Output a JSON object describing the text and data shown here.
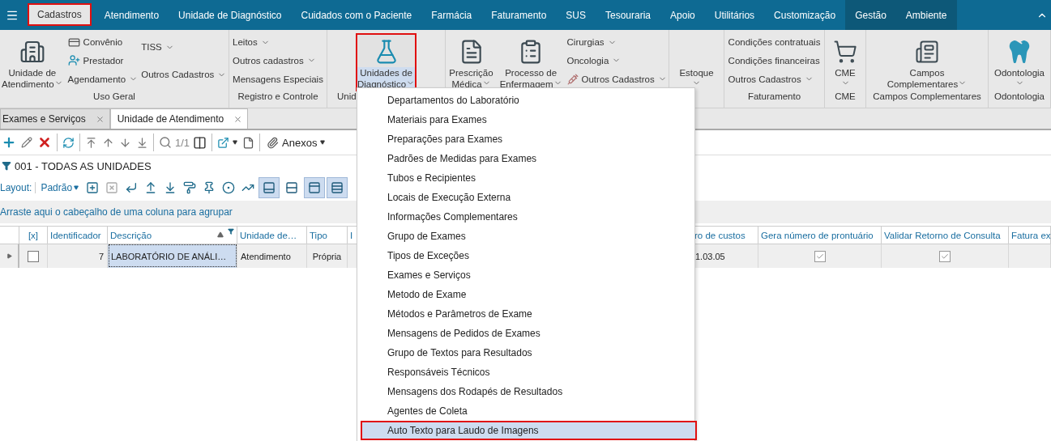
{
  "menu_bar": {
    "tabs": [
      {
        "label": "Cadastros",
        "selected": true,
        "context": false,
        "marked": true
      },
      {
        "label": "Atendimento",
        "selected": false,
        "context": false,
        "marked": false
      },
      {
        "label": "Unidade de Diagnóstico",
        "selected": false,
        "context": false,
        "marked": false
      },
      {
        "label": "Cuidados com o Paciente",
        "selected": false,
        "context": false,
        "marked": false
      },
      {
        "label": "Farmácia",
        "selected": false,
        "context": false,
        "marked": false
      },
      {
        "label": "Faturamento",
        "selected": false,
        "context": false,
        "marked": false
      },
      {
        "label": "SUS",
        "selected": false,
        "context": false,
        "marked": false
      },
      {
        "label": "Tesouraria",
        "selected": false,
        "context": false,
        "marked": false
      },
      {
        "label": "Apoio",
        "selected": false,
        "context": false,
        "marked": false
      },
      {
        "label": "Utilitários",
        "selected": false,
        "context": false,
        "marked": false
      },
      {
        "label": "Customização",
        "selected": false,
        "context": false,
        "marked": false
      },
      {
        "label": "Gestão",
        "selected": false,
        "context": true,
        "marked": false
      },
      {
        "label": "Ambiente",
        "selected": false,
        "context": true,
        "marked": false
      }
    ]
  },
  "ribbon": {
    "groups": [
      {
        "label": "Uso Geral",
        "columns": [
          {
            "kind": "large",
            "lines": [
              "Unidade de",
              "Atendimento"
            ],
            "dropdown": true,
            "selected": false,
            "marked": false
          },
          {
            "kind": "stack",
            "items": [
              {
                "label": "Convênio",
                "dropdown": false
              },
              {
                "label": "Prestador",
                "dropdown": false
              },
              {
                "label": "Agendamento",
                "dropdown": true
              }
            ]
          },
          {
            "kind": "stack",
            "items": [
              {
                "label": "TISS",
                "dropdown": true
              },
              {
                "label": "Outros Cadastros",
                "dropdown": true
              }
            ]
          }
        ]
      },
      {
        "label": "Registro e Controle",
        "columns": [
          {
            "kind": "stack",
            "items": [
              {
                "label": "Leitos",
                "dropdown": true
              },
              {
                "label": "Outros cadastros",
                "dropdown": true
              },
              {
                "label": "Mensagens  Especiais",
                "dropdown": false
              }
            ]
          }
        ]
      },
      {
        "label": "Unid",
        "columns": [
          {
            "kind": "large",
            "lines": [
              "Unidades de",
              "Diagnóstico"
            ],
            "dropdown": true,
            "selected": true,
            "marked": true
          }
        ]
      },
      {
        "columns": [
          {
            "kind": "large",
            "lines": [
              "Prescrição",
              "Médica"
            ],
            "dropdown": true,
            "selected": false,
            "marked": false
          },
          {
            "kind": "large",
            "lines": [
              "Processo de",
              "Enfermagem"
            ],
            "dropdown": true,
            "selected": false,
            "marked": false
          },
          {
            "kind": "stack",
            "items": [
              {
                "label": "Cirurgias",
                "dropdown": true
              },
              {
                "label": "Oncologia",
                "dropdown": true
              },
              {
                "label": "Outros Cadastros",
                "dropdown": true
              }
            ]
          }
        ]
      },
      {
        "columns": [
          {
            "kind": "large",
            "lines": [
              "Estoque"
            ],
            "dropdown": true,
            "selected": false,
            "marked": false
          }
        ]
      },
      {
        "label": "Faturamento",
        "columns": [
          {
            "kind": "stack",
            "items": [
              {
                "label": "Condições contratuais",
                "dropdown": false
              },
              {
                "label": "Condições financeiras",
                "dropdown": false
              },
              {
                "label": "Outros Cadastros",
                "dropdown": true
              }
            ]
          }
        ]
      },
      {
        "label": "CME",
        "columns": [
          {
            "kind": "large",
            "lines": [
              "CME"
            ],
            "dropdown": true,
            "selected": false,
            "marked": false
          }
        ]
      },
      {
        "label": "Campos Complementares",
        "columns": [
          {
            "kind": "large",
            "lines": [
              "Campos",
              "Complementares"
            ],
            "dropdown": true,
            "selected": false,
            "marked": false
          }
        ]
      },
      {
        "label": "Odontologia",
        "columns": [
          {
            "kind": "large",
            "lines": [
              "Odontologia"
            ],
            "dropdown": true,
            "selected": false,
            "marked": false
          }
        ]
      }
    ]
  },
  "document_tabs": [
    {
      "label": "Exames e Serviços",
      "selected": false
    },
    {
      "label": "Unidade de Atendimento",
      "selected": true
    }
  ],
  "toolbar": {
    "page_counter": "1/1",
    "attachments_label": "Anexos"
  },
  "filter": {
    "label": "001 - TODAS AS UNIDADES"
  },
  "layout_bar": {
    "label": "Layout:",
    "preset": "Padrão",
    "toggles": [
      {
        "selected": true
      },
      {
        "selected": false
      },
      {
        "selected": true
      },
      {
        "selected": true
      }
    ]
  },
  "group_panel": {
    "hint": "Arraste aqui o cabeçalho de uma coluna para agrupar"
  },
  "table": {
    "columns": [
      {
        "label": "[x]"
      },
      {
        "label": "Identificador"
      },
      {
        "label": "Descrição",
        "sorted": true,
        "filtered": true
      },
      {
        "label": "Unidade de…"
      },
      {
        "label": "Tipo"
      },
      {
        "label": "I"
      },
      {
        "label": "ro de custos"
      },
      {
        "label": "Gera número de prontuário"
      },
      {
        "label": "Validar Retorno de Consulta"
      },
      {
        "label": "Fatura ex"
      }
    ],
    "rows": [
      {
        "current": true,
        "cells": [
          {
            "kind": "check",
            "checked": false,
            "focused": false
          },
          {
            "kind": "text",
            "text": "7",
            "focused": false
          },
          {
            "kind": "text",
            "text": "LABORATÓRIO DE ANÁLI…",
            "focused": true
          },
          {
            "kind": "text",
            "text": "Atendimento",
            "focused": false
          },
          {
            "kind": "text",
            "text": "Própria",
            "focused": false
          },
          {
            "kind": "empty",
            "focused": false
          },
          {
            "kind": "text",
            "text": "1.03.05",
            "focused": false
          },
          {
            "kind": "check",
            "checked": true,
            "focused": false
          },
          {
            "kind": "check",
            "checked": true,
            "focused": false
          },
          {
            "kind": "empty",
            "focused": false
          }
        ]
      }
    ]
  },
  "dropdown_menu": {
    "items": [
      {
        "label": "Departamentos do Laboratório",
        "selected": false,
        "marked": false
      },
      {
        "label": "Materiais para Exames",
        "selected": false,
        "marked": false
      },
      {
        "label": "Preparações para Exames",
        "selected": false,
        "marked": false
      },
      {
        "label": "Padrões de Medidas para Exames",
        "selected": false,
        "marked": false
      },
      {
        "label": "Tubos e Recipientes",
        "selected": false,
        "marked": false
      },
      {
        "label": "Locais de Execução Externa",
        "selected": false,
        "marked": false
      },
      {
        "label": "Informações Complementares",
        "selected": false,
        "marked": false
      },
      {
        "label": "Grupo de Exames",
        "selected": false,
        "marked": false
      },
      {
        "label": "Tipos de Exceções",
        "selected": false,
        "marked": false
      },
      {
        "label": "Exames e Serviços",
        "selected": false,
        "marked": false
      },
      {
        "label": "Metodo de Exame",
        "selected": false,
        "marked": false
      },
      {
        "label": "Métodos e Parâmetros de Exame",
        "selected": false,
        "marked": false
      },
      {
        "label": "Mensagens de Pedidos de Exames",
        "selected": false,
        "marked": false
      },
      {
        "label": "Grupo de Textos para Resultados",
        "selected": false,
        "marked": false
      },
      {
        "label": "Responsáveis Técnicos",
        "selected": false,
        "marked": false
      },
      {
        "label": "Mensagens dos Rodapés de Resultados",
        "selected": false,
        "marked": false
      },
      {
        "label": "Agentes de Coleta",
        "selected": false,
        "marked": false
      },
      {
        "label": "Auto Texto para Laudo de Imagens",
        "selected": true,
        "marked": true
      }
    ]
  }
}
